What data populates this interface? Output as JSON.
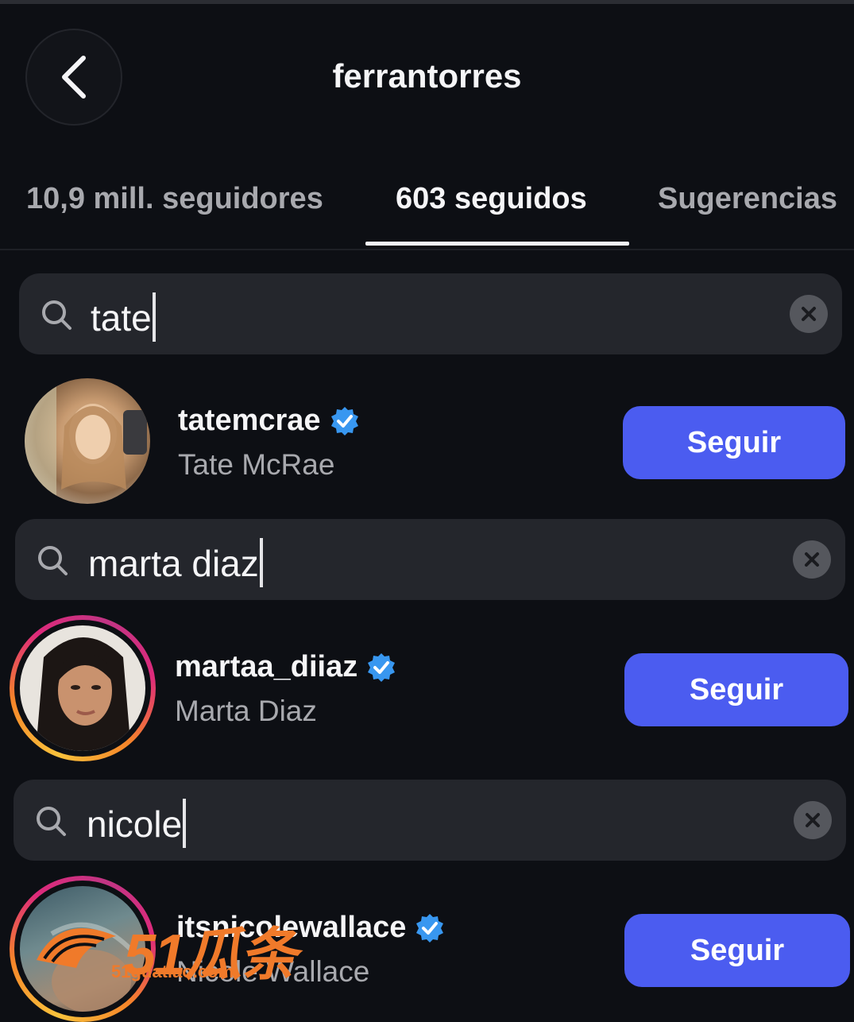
{
  "header": {
    "title": "ferrantorres"
  },
  "tabs": [
    {
      "label": "10,9 mill. seguidores",
      "active": false
    },
    {
      "label": "603 seguidos",
      "active": true
    },
    {
      "label": "Sugerencias",
      "active": false
    }
  ],
  "searches": [
    {
      "value": "tate"
    },
    {
      "value": "marta diaz"
    },
    {
      "value": "nicole"
    }
  ],
  "results": [
    {
      "username": "tatemcrae",
      "full_name": "Tate McRae",
      "verified": true,
      "has_story_ring": false,
      "button_label": "Seguir"
    },
    {
      "username": "martaa_diiaz",
      "full_name": "Marta Diaz",
      "verified": true,
      "has_story_ring": true,
      "button_label": "Seguir"
    },
    {
      "username": "itsnicolewallace",
      "full_name": "Nicole Wallace",
      "verified": true,
      "has_story_ring": true,
      "button_label": "Seguir"
    }
  ],
  "watermark": {
    "main": "51瓜条",
    "sub": "51guatiao.com"
  },
  "colors": {
    "background": "#0d0f14",
    "search_bg": "#24262c",
    "button": "#4b5cf0",
    "verified": "#3897f0",
    "secondary_text": "#a8a9ae",
    "watermark": "#f07a2a"
  }
}
